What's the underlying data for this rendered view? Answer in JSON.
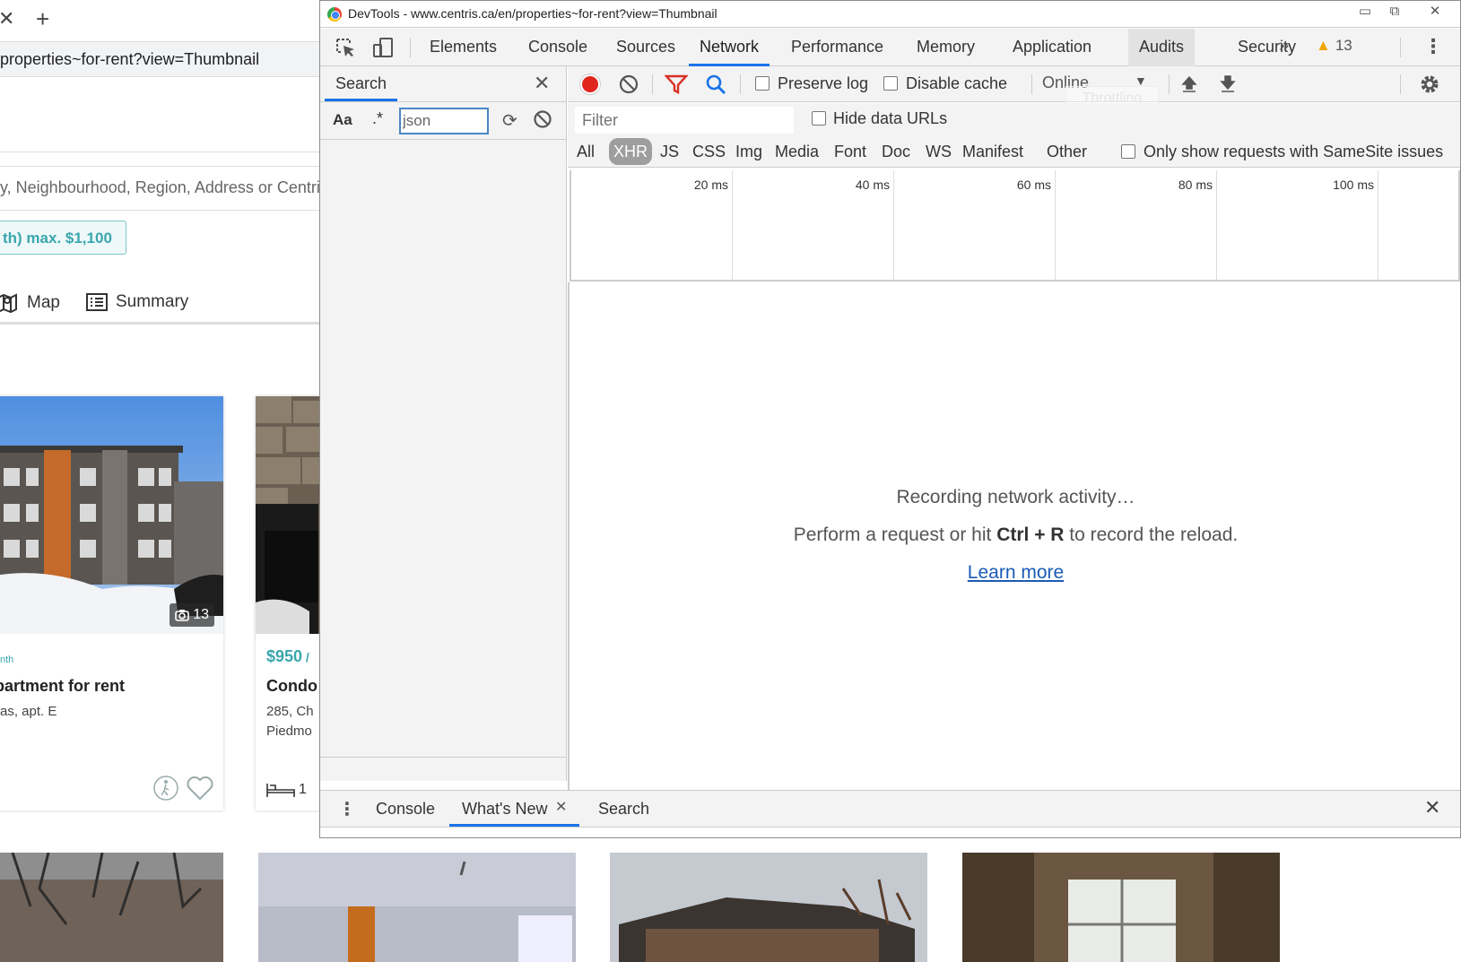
{
  "page": {
    "tab_close_glyph": "✕",
    "tab_new_glyph": "+",
    "url_fragment": "properties~for-rent?view=Thumbnail",
    "location_placeholder": "y, Neighbourhood, Region, Address or Centri",
    "price_chip": "th) max. $1,100",
    "view_map": "Map",
    "view_summary": "Summary",
    "cards": [
      {
        "price_small": "nth",
        "title": "partment for rent",
        "address": "as, apt. E",
        "photo_count": "13"
      },
      {
        "price": "$950",
        "price_suffix": " /",
        "title": "Condo",
        "address_line1": "285, Ch",
        "address_line2": "Piedmo",
        "bedrooms": "1"
      }
    ]
  },
  "devtools": {
    "title": "DevTools - www.centris.ca/en/properties~for-rent?view=Thumbnail",
    "tabs": [
      "Elements",
      "Console",
      "Sources",
      "Network",
      "Performance",
      "Memory",
      "Application",
      "Audits",
      "Security"
    ],
    "active_tab": "Network",
    "more_tabs_glyph": "»",
    "warning_count": "13",
    "search": {
      "title": "Search",
      "case_label": "Aa",
      "regex_label": ".*",
      "query": "json"
    },
    "toolbar": {
      "preserve_log": "Preserve log",
      "disable_cache": "Disable cache",
      "throttling_value": "Online",
      "throttling_tooltip": "Throttling"
    },
    "filter": {
      "placeholder": "Filter",
      "hide_data_urls": "Hide data URLs",
      "types": [
        "All",
        "XHR",
        "JS",
        "CSS",
        "Img",
        "Media",
        "Font",
        "Doc",
        "WS",
        "Manifest",
        "Other"
      ],
      "active_type": "XHR",
      "samesite_label": "Only show requests with SameSite issues"
    },
    "timeline": {
      "ticks": [
        "20 ms",
        "40 ms",
        "60 ms",
        "80 ms",
        "100 ms"
      ]
    },
    "empty_state": {
      "line1": "Recording network activity…",
      "line2_pre": "Perform a request or hit ",
      "line2_key": "Ctrl + R",
      "line2_post": " to record the reload.",
      "link": "Learn more"
    },
    "drawer": {
      "tabs": [
        "Console",
        "What's New",
        "Search"
      ],
      "active_tab": "What's New"
    }
  },
  "colors": {
    "accent_blue": "#1a73e8",
    "record_red": "#e0261c",
    "warning_yellow": "#f2a600",
    "brand_teal": "#3aa6ad"
  }
}
